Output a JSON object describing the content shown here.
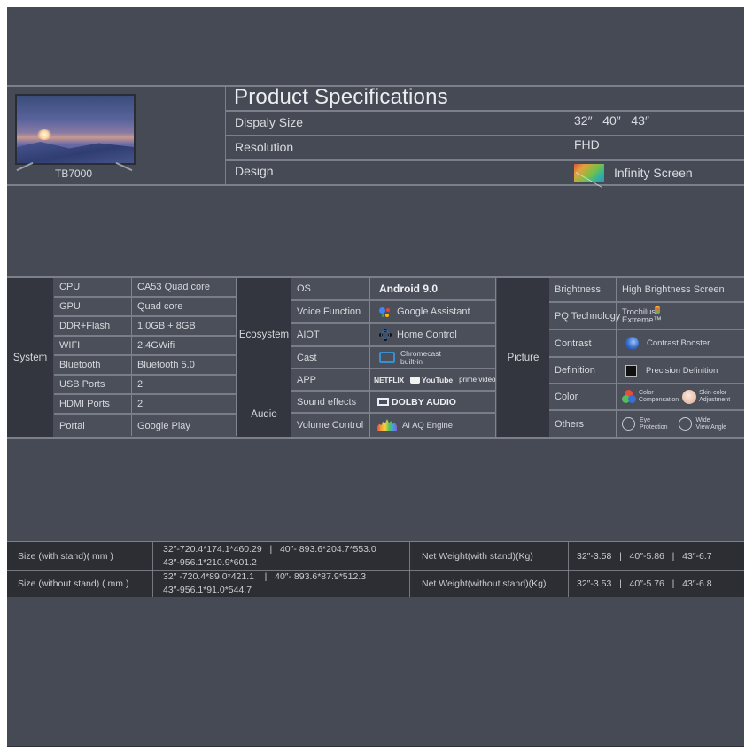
{
  "header": {
    "model": "TB7000",
    "title": "Product Specifications",
    "rows": [
      {
        "label": "Dispaly Size",
        "value": "32″   40″   43″"
      },
      {
        "label": "Resolution",
        "value": "FHD"
      },
      {
        "label": "Design",
        "value": "Infinity Screen",
        "icon": "infinity-screen-icon"
      }
    ]
  },
  "system": {
    "group": "System",
    "rows": [
      {
        "label": "CPU",
        "value": "CA53 Quad core"
      },
      {
        "label": "GPU",
        "value": "Quad core"
      },
      {
        "label": "DDR+Flash",
        "value": "1.0GB + 8GB"
      },
      {
        "label": "WIFI",
        "value": "2.4GWifi"
      },
      {
        "label": "Bluetooth",
        "value": "Bluetooth 5.0"
      },
      {
        "label": "USB Ports",
        "value": "2"
      },
      {
        "label": "HDMI Ports",
        "value": "2"
      },
      {
        "label": "Portal",
        "value": "Google Play"
      }
    ]
  },
  "ecosystem": {
    "group": "Ecosystem",
    "rows": [
      {
        "label": "OS",
        "value": "Android 9.0"
      },
      {
        "label": "Voice Function",
        "value": "Google Assistant",
        "icon": "google-assistant-icon"
      },
      {
        "label": "AIOT",
        "value": "Home Control",
        "icon": "home-control-icon"
      },
      {
        "label": "Cast",
        "value": "Chromecast",
        "value2": "built-in",
        "icon": "chromecast-icon"
      },
      {
        "label": "APP",
        "apps": [
          "NETFLIX",
          "YouTube",
          "prime video"
        ]
      }
    ]
  },
  "audio": {
    "group": "Audio",
    "rows": [
      {
        "label": "Sound effects",
        "value": "DOLBY AUDIO",
        "icon": "dolby-icon"
      },
      {
        "label": "Volume Control",
        "value": "AI AQ Engine",
        "icon": "equalizer-icon"
      }
    ]
  },
  "picture": {
    "group": "Picture",
    "rows": [
      {
        "label": "Brightness",
        "value": "High Brightness Screen"
      },
      {
        "label": "PQ Technology",
        "value": "Trochilus",
        "value2": "Extreme™",
        "icon": "trochilus-icon"
      },
      {
        "label": "Contrast",
        "value": "Contrast Booster",
        "icon": "contrast-booster-icon"
      },
      {
        "label": "Definition",
        "value": "Precision Definition",
        "icon": "precision-definition-icon"
      },
      {
        "label": "Color",
        "items": [
          {
            "line1": "Color",
            "line2": "Compensation",
            "icon": "color-compensation-icon"
          },
          {
            "line1": "Skin-color",
            "line2": "Adjustment",
            "icon": "skin-color-icon"
          }
        ]
      },
      {
        "label": "Others",
        "items": [
          {
            "line1": "Eye",
            "line2": "Protection",
            "icon": "eye-protection-icon"
          },
          {
            "line1": "Wide",
            "line2": "View Angle",
            "icon": "wide-view-angle-icon"
          }
        ]
      }
    ]
  },
  "dimensions": {
    "rows": [
      {
        "label": "Size (with stand)( mm )",
        "line1": "32″-720.4*174.1*460.29   |   40″- 893.6*204.7*553.0",
        "line2": "43″-956.1*210.9*601.2",
        "weight_label": "Net Weight(with stand)(Kg)",
        "weight": "32″-3.58   |   40″-5.86   |   43″-6.7"
      },
      {
        "label": "Size (without stand) ( mm )",
        "line1": "32″ -720.4*89.0*421.1    |   40″- 893.6*87.9*512.3",
        "line2": "43″-956.1*91.0*544.7",
        "weight_label": "Net Weight(without stand)(Kg)",
        "weight": "32″-3.53   |   40″-5.76   |   43″-6.8"
      }
    ]
  },
  "colors": {
    "background": "#454a54",
    "group_cell": "#33363e",
    "bottom_table": "#2c2e33",
    "text": "#d6d8dc"
  }
}
